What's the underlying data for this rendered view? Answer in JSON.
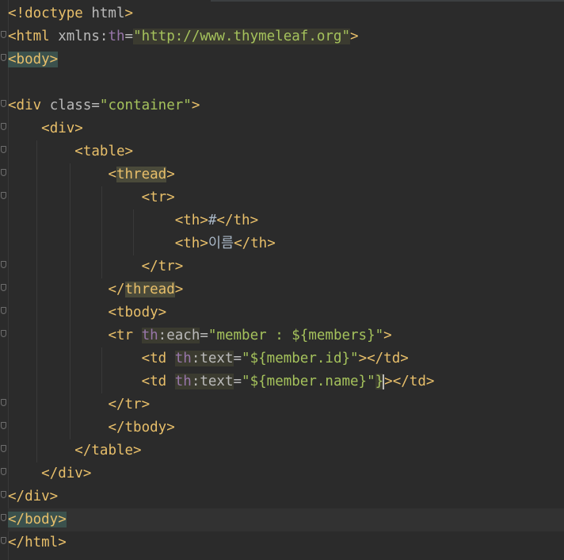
{
  "editor": {
    "language": "html",
    "colors": {
      "background": "#2b2b2b",
      "tag": "#e8bf6a",
      "attribute": "#bababa",
      "namespace": "#9876aa",
      "string": "#a5c25c",
      "text": "#a9b7c6"
    },
    "lines": [
      {
        "doctype_open": "<!doctype ",
        "doctype_name": "html",
        "doctype_close": ">"
      },
      {
        "tag": "<html ",
        "attr": "xmlns:",
        "ns": "th",
        "eq": "=",
        "value": "\"http://www.thymeleaf.org\"",
        "close": ">"
      },
      {
        "tag": "<body>"
      },
      {},
      {
        "tag": "<div ",
        "attr": "class",
        "eq": "=",
        "value": "\"container\"",
        "close": ">"
      },
      {
        "indent": "    ",
        "tag": "<div>"
      },
      {
        "indent": "        ",
        "tag": "<table>"
      },
      {
        "indent": "            ",
        "open": "<",
        "name": "thread",
        "close": ">"
      },
      {
        "indent": "                ",
        "tag": "<tr>"
      },
      {
        "indent": "                    ",
        "open": "<th>",
        "content": "#",
        "close": "</th>"
      },
      {
        "indent": "                    ",
        "open": "<th>",
        "content": "이름",
        "close": "</th>"
      },
      {
        "indent": "                ",
        "tag": "</tr>"
      },
      {
        "indent": "            ",
        "open": "</",
        "name": "thread",
        "close": ">"
      },
      {
        "indent": "            ",
        "tag": "<tbody>"
      },
      {
        "indent": "            ",
        "tag": "<tr ",
        "ns": "th",
        "attr": ":each",
        "eq": "=",
        "value": "\"member : ${members}\"",
        "close": ">"
      },
      {
        "indent": "                ",
        "tag": "<td ",
        "ns": "th",
        "attr": ":text",
        "eq": "=",
        "value": "\"${member.id}\"",
        "close": "></td>"
      },
      {
        "indent": "                ",
        "tag": "<td ",
        "ns": "th",
        "attr": ":text",
        "eq": "=",
        "value_a": "\"${member.name}\"",
        "value_b": "}",
        "close": "></td>"
      },
      {
        "indent": "            ",
        "tag": "</tr>"
      },
      {
        "indent": "            ",
        "tag": "</tbody>"
      },
      {
        "indent": "        ",
        "tag": "</table>"
      },
      {
        "indent": "    ",
        "tag": "</div>"
      },
      {
        "tag": "</div>"
      },
      {
        "tag": "</body>"
      },
      {
        "tag": "</html>"
      }
    ]
  }
}
